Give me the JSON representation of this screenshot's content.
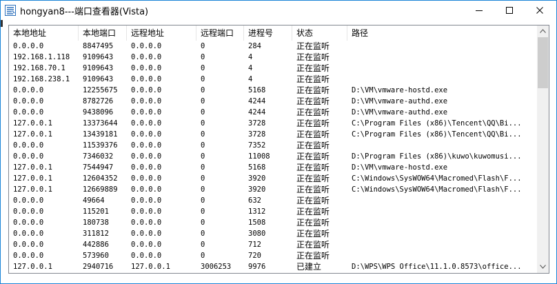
{
  "window": {
    "title": "hongyan8---端口查看器(Vista)",
    "icon": "app-logo-icon",
    "controls": {
      "minimize": "minimize-icon",
      "maximize": "maximize-icon",
      "close": "close-icon"
    }
  },
  "colors": {
    "border": "#1883d7",
    "list_border": "#828790",
    "scrollbar_track": "#f0f0f0",
    "scrollbar_thumb": "#cdcdcd"
  },
  "table": {
    "columns": [
      "本地地址",
      "本地端口",
      "远程地址",
      "远程端口",
      "进程号",
      "状态",
      "路径"
    ],
    "rows": [
      [
        "0.0.0.0",
        "8847495",
        "0.0.0.0",
        "0",
        "284",
        "正在监听",
        ""
      ],
      [
        "192.168.1.118",
        "9109643",
        "0.0.0.0",
        "0",
        "4",
        "正在监听",
        ""
      ],
      [
        "192.168.70.1",
        "9109643",
        "0.0.0.0",
        "0",
        "4",
        "正在监听",
        ""
      ],
      [
        "192.168.238.1",
        "9109643",
        "0.0.0.0",
        "0",
        "4",
        "正在监听",
        ""
      ],
      [
        "0.0.0.0",
        "12255675",
        "0.0.0.0",
        "0",
        "5168",
        "正在监听",
        "D:\\VM\\vmware-hostd.exe"
      ],
      [
        "0.0.0.0",
        "8782726",
        "0.0.0.0",
        "0",
        "4244",
        "正在监听",
        "D:\\VM\\vmware-authd.exe"
      ],
      [
        "0.0.0.0",
        "9438096",
        "0.0.0.0",
        "0",
        "4244",
        "正在监听",
        "D:\\VM\\vmware-authd.exe"
      ],
      [
        "127.0.0.1",
        "13373644",
        "0.0.0.0",
        "0",
        "3728",
        "正在监听",
        "C:\\Program Files (x86)\\Tencent\\QQ\\Bi..."
      ],
      [
        "127.0.0.1",
        "13439181",
        "0.0.0.0",
        "0",
        "3728",
        "正在监听",
        "C:\\Program Files (x86)\\Tencent\\QQ\\Bi..."
      ],
      [
        "0.0.0.0",
        "11539376",
        "0.0.0.0",
        "0",
        "7352",
        "正在监听",
        ""
      ],
      [
        "0.0.0.0",
        "7346032",
        "0.0.0.0",
        "0",
        "11008",
        "正在监听",
        "D:\\Program Files (x86)\\kuwo\\kuwomusi..."
      ],
      [
        "127.0.0.1",
        "7544947",
        "0.0.0.0",
        "0",
        "5168",
        "正在监听",
        "D:\\VM\\vmware-hostd.exe"
      ],
      [
        "127.0.0.1",
        "12604352",
        "0.0.0.0",
        "0",
        "3920",
        "正在监听",
        "C:\\Windows\\SysWOW64\\Macromed\\Flash\\F..."
      ],
      [
        "127.0.0.1",
        "12669889",
        "0.0.0.0",
        "0",
        "3920",
        "正在监听",
        "C:\\Windows\\SysWOW64\\Macromed\\Flash\\F..."
      ],
      [
        "0.0.0.0",
        "49664",
        "0.0.0.0",
        "0",
        "632",
        "正在监听",
        ""
      ],
      [
        "0.0.0.0",
        "115201",
        "0.0.0.0",
        "0",
        "1312",
        "正在监听",
        ""
      ],
      [
        "0.0.0.0",
        "180738",
        "0.0.0.0",
        "0",
        "1508",
        "正在监听",
        ""
      ],
      [
        "0.0.0.0",
        "311812",
        "0.0.0.0",
        "0",
        "3080",
        "正在监听",
        ""
      ],
      [
        "0.0.0.0",
        "442886",
        "0.0.0.0",
        "0",
        "712",
        "正在监听",
        ""
      ],
      [
        "0.0.0.0",
        "573960",
        "0.0.0.0",
        "0",
        "720",
        "正在监听",
        ""
      ],
      [
        "127.0.0.1",
        "2940716",
        "127.0.0.1",
        "3006253",
        "9976",
        "已建立",
        "D:\\WPS\\WPS Office\\11.1.0.8573\\office..."
      ]
    ]
  }
}
